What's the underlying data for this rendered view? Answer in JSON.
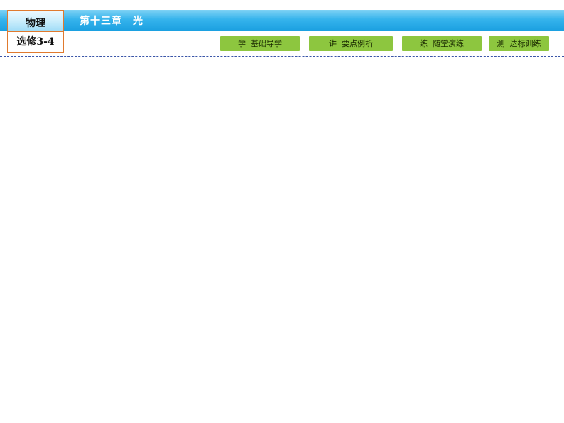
{
  "header": {
    "subject": "物理",
    "module": "选修3-4",
    "chapter": "第十三章　光"
  },
  "nav": {
    "buttons": [
      {
        "label": "学  基础导学"
      },
      {
        "label": "讲  要点例析"
      },
      {
        "label": "练  随堂演练"
      },
      {
        "label": "测  达标训练"
      }
    ]
  },
  "colors": {
    "top_bar": "#1a9fe0",
    "button_green": "#8dc63f",
    "box_border": "#e07a2e",
    "dashed_line": "#3a55a8"
  }
}
